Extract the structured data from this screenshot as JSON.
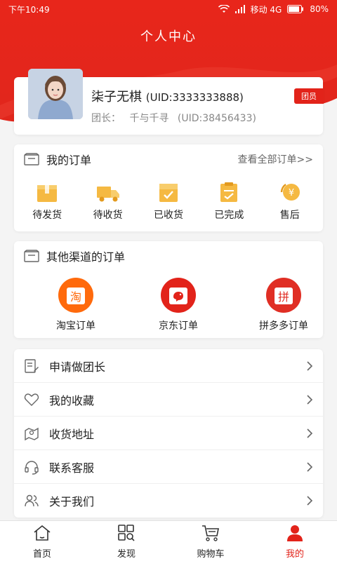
{
  "status": {
    "time": "下午10:49",
    "carrier": "移动 4G",
    "battery": "80%"
  },
  "header": {
    "title": "个人中心"
  },
  "profile": {
    "name": "柒子无棋",
    "uid": "(UID:3333333888)",
    "leader_label": "团长：",
    "leader_name": "千与千寻",
    "leader_uid": "(UID:38456433)",
    "badge": "团员"
  },
  "orders": {
    "title": "我的订单",
    "more": "查看全部订单>>",
    "items": [
      {
        "label": "待发货",
        "icon": "box-icon"
      },
      {
        "label": "待收货",
        "icon": "truck-icon"
      },
      {
        "label": "已收货",
        "icon": "received-box-icon"
      },
      {
        "label": "已完成",
        "icon": "completed-icon"
      },
      {
        "label": "售后",
        "icon": "after-sale-icon"
      }
    ]
  },
  "channels": {
    "title": "其他渠道的订单",
    "items": [
      {
        "label": "淘宝订单",
        "glyph": "淘",
        "color": "#ff6a0c"
      },
      {
        "label": "京东订单",
        "glyph": "",
        "color": "#e2231a"
      },
      {
        "label": "拼多多订单",
        "glyph": "拼",
        "color": "#e02e24"
      }
    ]
  },
  "menu": {
    "items": [
      {
        "label": "申请做团长",
        "icon": "apply-icon"
      },
      {
        "label": "我的收藏",
        "icon": "heart-icon"
      },
      {
        "label": "收货地址",
        "icon": "map-pin-icon"
      },
      {
        "label": "联系客服",
        "icon": "headset-icon"
      },
      {
        "label": "关于我们",
        "icon": "users-icon"
      }
    ]
  },
  "tabbar": {
    "items": [
      {
        "label": "首页",
        "icon": "home-icon"
      },
      {
        "label": "发现",
        "icon": "discover-icon"
      },
      {
        "label": "购物车",
        "icon": "cart-icon"
      },
      {
        "label": "我的",
        "icon": "user-icon",
        "active": true
      }
    ]
  },
  "colors": {
    "brand_red": "#e2231a",
    "order_icon": "#f5b942",
    "bg": "#f4f4f4"
  }
}
